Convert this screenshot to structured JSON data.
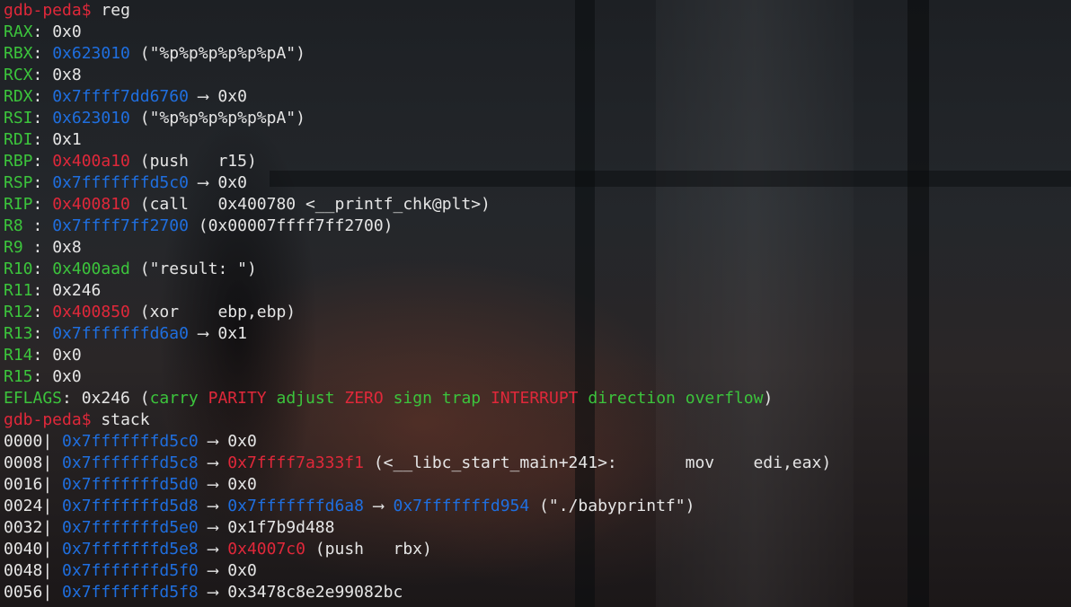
{
  "colors": {
    "prompt": "#e0283a",
    "register_name": "#3cc43c",
    "address_stack": "#1f6fe0",
    "address_code": "#e0283a",
    "address_data": "#3cc43c",
    "text": "#e6e6e6"
  },
  "prompt": "gdb-peda$",
  "commands": {
    "reg": "reg",
    "stack": "stack"
  },
  "registers": [
    {
      "name": "RAX",
      "sep": ": ",
      "value": "0x0",
      "value_type": "plain",
      "rest": ""
    },
    {
      "name": "RBX",
      "sep": ": ",
      "value": "0x623010",
      "value_type": "stack",
      "rest": " (\"%p%p%p%p%p%pA\")"
    },
    {
      "name": "RCX",
      "sep": ": ",
      "value": "0x8",
      "value_type": "plain",
      "rest": ""
    },
    {
      "name": "RDX",
      "sep": ": ",
      "value": "0x7ffff7dd6760",
      "value_type": "stack",
      "rest": " ⟶ 0x0"
    },
    {
      "name": "RSI",
      "sep": ": ",
      "value": "0x623010",
      "value_type": "stack",
      "rest": " (\"%p%p%p%p%p%pA\")"
    },
    {
      "name": "RDI",
      "sep": ": ",
      "value": "0x1",
      "value_type": "plain",
      "rest": ""
    },
    {
      "name": "RBP",
      "sep": ": ",
      "value": "0x400a10",
      "value_type": "code",
      "rest": " (push   r15)"
    },
    {
      "name": "RSP",
      "sep": ": ",
      "value": "0x7fffffffd5c0",
      "value_type": "stack",
      "rest": " ⟶ 0x0"
    },
    {
      "name": "RIP",
      "sep": ": ",
      "value": "0x400810",
      "value_type": "code",
      "rest": " (call   0x400780 <__printf_chk@plt>)"
    },
    {
      "name": "R8",
      "sep": " : ",
      "value": "0x7ffff7ff2700",
      "value_type": "stack",
      "rest": " (0x00007ffff7ff2700)"
    },
    {
      "name": "R9",
      "sep": " : ",
      "value": "0x8",
      "value_type": "plain",
      "rest": ""
    },
    {
      "name": "R10",
      "sep": ": ",
      "value": "0x400aad",
      "value_type": "data",
      "rest": " (\"result: \")"
    },
    {
      "name": "R11",
      "sep": ": ",
      "value": "0x246",
      "value_type": "plain",
      "rest": ""
    },
    {
      "name": "R12",
      "sep": ": ",
      "value": "0x400850",
      "value_type": "code",
      "rest": " (xor    ebp,ebp)"
    },
    {
      "name": "R13",
      "sep": ": ",
      "value": "0x7fffffffd6a0",
      "value_type": "stack",
      "rest": " ⟶ 0x1"
    },
    {
      "name": "R14",
      "sep": ": ",
      "value": "0x0",
      "value_type": "plain",
      "rest": ""
    },
    {
      "name": "R15",
      "sep": ": ",
      "value": "0x0",
      "value_type": "plain",
      "rest": ""
    }
  ],
  "eflags": {
    "name": "EFLAGS",
    "value": ": 0x246 (",
    "flags": [
      {
        "text": "carry",
        "set": false
      },
      {
        "text": "PARITY",
        "set": true
      },
      {
        "text": "adjust",
        "set": false
      },
      {
        "text": "ZERO",
        "set": true
      },
      {
        "text": "sign",
        "set": false
      },
      {
        "text": "trap",
        "set": false
      },
      {
        "text": "INTERRUPT",
        "set": true
      },
      {
        "text": "direction",
        "set": false
      },
      {
        "text": "overflow",
        "set": false
      }
    ],
    "close": ")"
  },
  "stack": [
    {
      "offset": "0000|",
      "addr": "0x7fffffffd5c0",
      "chain": [
        {
          "text": " ⟶ ",
          "type": "plain"
        },
        {
          "text": "0x0",
          "type": "plain"
        }
      ]
    },
    {
      "offset": "0008|",
      "addr": "0x7fffffffd5c8",
      "chain": [
        {
          "text": " ⟶ ",
          "type": "plain"
        },
        {
          "text": "0x7ffff7a333f1",
          "type": "code"
        },
        {
          "text": " (<__libc_start_main+241>:       mov    edi,eax)",
          "type": "plain"
        }
      ]
    },
    {
      "offset": "0016|",
      "addr": "0x7fffffffd5d0",
      "chain": [
        {
          "text": " ⟶ ",
          "type": "plain"
        },
        {
          "text": "0x0",
          "type": "plain"
        }
      ]
    },
    {
      "offset": "0024|",
      "addr": "0x7fffffffd5d8",
      "chain": [
        {
          "text": " ⟶ ",
          "type": "plain"
        },
        {
          "text": "0x7fffffffd6a8",
          "type": "stack"
        },
        {
          "text": " ⟶ ",
          "type": "plain"
        },
        {
          "text": "0x7fffffffd954",
          "type": "stack"
        },
        {
          "text": " (\"./babyprintf\")",
          "type": "plain"
        }
      ]
    },
    {
      "offset": "0032|",
      "addr": "0x7fffffffd5e0",
      "chain": [
        {
          "text": " ⟶ ",
          "type": "plain"
        },
        {
          "text": "0x1f7b9d488",
          "type": "plain"
        }
      ]
    },
    {
      "offset": "0040|",
      "addr": "0x7fffffffd5e8",
      "chain": [
        {
          "text": " ⟶ ",
          "type": "plain"
        },
        {
          "text": "0x4007c0",
          "type": "code"
        },
        {
          "text": " (push   rbx)",
          "type": "plain"
        }
      ]
    },
    {
      "offset": "0048|",
      "addr": "0x7fffffffd5f0",
      "chain": [
        {
          "text": " ⟶ ",
          "type": "plain"
        },
        {
          "text": "0x0",
          "type": "plain"
        }
      ]
    },
    {
      "offset": "0056|",
      "addr": "0x7fffffffd5f8",
      "chain": [
        {
          "text": " ⟶ ",
          "type": "plain"
        },
        {
          "text": "0x3478c8e2e99082bc",
          "type": "plain"
        }
      ]
    }
  ]
}
